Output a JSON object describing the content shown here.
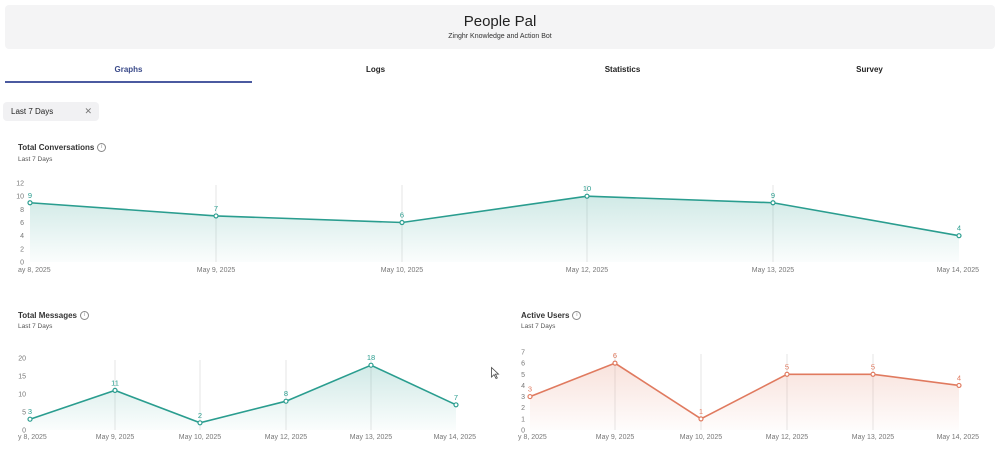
{
  "header": {
    "title": "People Pal",
    "subtitle": "Zinghr Knowledge and Action Bot"
  },
  "tabs": [
    {
      "label": "Graphs",
      "active": true
    },
    {
      "label": "Logs",
      "active": false
    },
    {
      "label": "Statistics",
      "active": false
    },
    {
      "label": "Survey",
      "active": false
    }
  ],
  "filter": {
    "label": "Last 7 Days",
    "close_icon": "close-icon"
  },
  "cards": {
    "conversations": {
      "title": "Total Conversations",
      "subtitle": "Last 7 Days",
      "info_icon": "info-icon"
    },
    "messages": {
      "title": "Total Messages",
      "subtitle": "Last 7 Days",
      "info_icon": "info-icon"
    },
    "users": {
      "title": "Active Users",
      "subtitle": "Last 7 Days",
      "info_icon": "info-icon"
    }
  },
  "chart_data": [
    {
      "type": "area",
      "title": "Total Conversations",
      "subtitle": "Last 7 Days",
      "color": "#2a9d8f",
      "categories": [
        "ay 8, 2025",
        "May 9, 2025",
        "May 10, 2025",
        "May 12, 2025",
        "May 13, 2025",
        "May 14, 2025"
      ],
      "values": [
        9,
        7,
        6,
        10,
        9,
        4
      ],
      "ylim": [
        0,
        12
      ],
      "yticks": [
        0,
        2,
        4,
        6,
        8,
        10,
        12
      ]
    },
    {
      "type": "area",
      "title": "Total Messages",
      "subtitle": "Last 7 Days",
      "color": "#2a9d8f",
      "categories": [
        "y 8, 2025",
        "May 9, 2025",
        "May 10, 2025",
        "May 12, 2025",
        "May 13, 2025",
        "May 14, 2025"
      ],
      "values": [
        3,
        11,
        2,
        8,
        18,
        7
      ],
      "ylim": [
        0,
        20
      ],
      "yticks": [
        0,
        5,
        10,
        15,
        20
      ]
    },
    {
      "type": "area",
      "title": "Active Users",
      "subtitle": "Last 7 Days",
      "color": "#e07a5f",
      "categories": [
        "y 8, 2025",
        "May 9, 2025",
        "May 10, 2025",
        "May 12, 2025",
        "May 13, 2025",
        "May 14, 2025"
      ],
      "values": [
        3,
        6,
        1,
        5,
        5,
        4
      ],
      "ylim": [
        0,
        7
      ],
      "yticks": [
        0,
        1,
        2,
        3,
        4,
        5,
        6,
        7
      ]
    }
  ]
}
